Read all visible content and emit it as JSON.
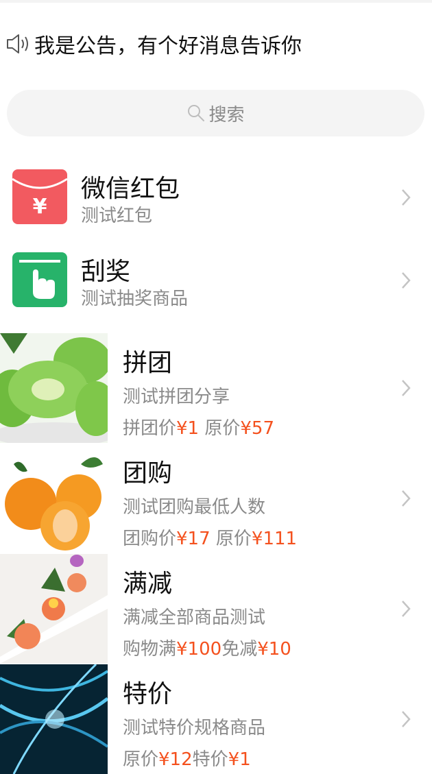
{
  "notice": {
    "text": "我是公告，有个好消息告诉你",
    "icon": "speaker-icon"
  },
  "search": {
    "label": "搜索",
    "icon": "search-icon"
  },
  "items": [
    {
      "title": "微信红包",
      "subtitle": "测试红包",
      "icon": "red-envelope-icon",
      "icon_color": "#f25a60"
    },
    {
      "title": "刮奖",
      "subtitle": "测试抽奖商品",
      "icon": "scratch-card-icon",
      "icon_color": "#27b36a"
    }
  ],
  "products": [
    {
      "title": "拼团",
      "subtitle": "测试拼团分享",
      "price": {
        "l1": "拼团价",
        "v1": "¥1",
        "l2": " 原价",
        "v2": "¥57"
      },
      "image": "kiwi-slices-image"
    },
    {
      "title": "团购",
      "subtitle": "测试团购最低人数",
      "price": {
        "l1": "团购价",
        "v1": "¥17",
        "l2": " 原价",
        "v2": "¥111"
      },
      "image": "tangerines-image"
    },
    {
      "title": "满减",
      "subtitle": "满减全部商品测试",
      "price": {
        "l1": "购物满",
        "v1": "¥100",
        "l2": "免减",
        "v2": "¥10"
      },
      "image": "salmon-rolls-image"
    },
    {
      "title": "特价",
      "subtitle": "测试特价规格商品",
      "price": {
        "l1": "原价",
        "v1": "¥12",
        "l2": "特价",
        "v2": "¥1"
      },
      "image": "dna-helix-image"
    }
  ],
  "colors": {
    "price_highlight": "#f4511e",
    "secondary_text": "#8a8a8a",
    "search_bg": "#f4f4f4"
  }
}
